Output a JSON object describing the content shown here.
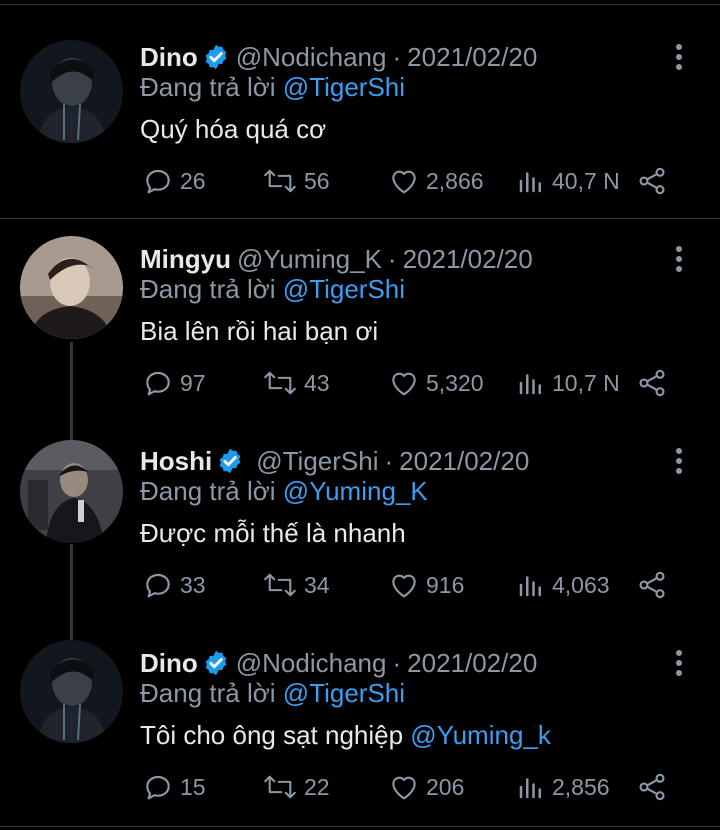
{
  "tweets": [
    {
      "name": "Dino",
      "verified": true,
      "handle": "@Nodichang",
      "date": "2021/02/20",
      "replying_prefix": "Đang trả lời",
      "replying_to": "@TigerShi",
      "text": "Quý hóa quá cơ",
      "text_mention": "",
      "replies": "26",
      "retweets": "56",
      "likes": "2,866",
      "views": "40,7 N",
      "avatar_colors": [
        "#1a1f2a",
        "#2e3440"
      ]
    },
    {
      "name": "Mingyu",
      "verified": false,
      "handle": "@Yuming_K",
      "date": "2021/02/20",
      "replying_prefix": "Đang trả lời",
      "replying_to": "@TigerShi",
      "text": "Bia lên rồi hai bạn ơi",
      "text_mention": "",
      "replies": "97",
      "retweets": "43",
      "likes": "5,320",
      "views": "10,7 N",
      "avatar_colors": [
        "#8a7b70",
        "#c7b8aa"
      ]
    },
    {
      "name": "Hoshi",
      "verified": true,
      "handle": "@TigerShi",
      "date": "2021/02/20",
      "replying_prefix": "Đang trả lời",
      "replying_to": "@Yuming_K",
      "text": "Được mỗi thế là nhanh",
      "text_mention": "",
      "replies": "33",
      "retweets": "34",
      "likes": "916",
      "views": "4,063",
      "avatar_colors": [
        "#2f3035",
        "#585a60"
      ]
    },
    {
      "name": "Dino",
      "verified": true,
      "handle": "@Nodichang",
      "date": "2021/02/20",
      "replying_prefix": "Đang trả lời",
      "replying_to": "@TigerShi",
      "text": "Tôi cho ông sạt nghiệp ",
      "text_mention": "@Yuming_k",
      "replies": "15",
      "retweets": "22",
      "likes": "206",
      "views": "2,856",
      "avatar_colors": [
        "#1a1f2a",
        "#2e3440"
      ]
    }
  ],
  "colors": {
    "accent": "#1d9bf0",
    "mention": "#3b9ef0",
    "muted": "#8b98a5",
    "background": "#000000"
  },
  "icons": [
    "reply-icon",
    "retweet-icon",
    "like-icon",
    "views-icon",
    "share-icon",
    "more-icon",
    "verified-badge-icon"
  ]
}
